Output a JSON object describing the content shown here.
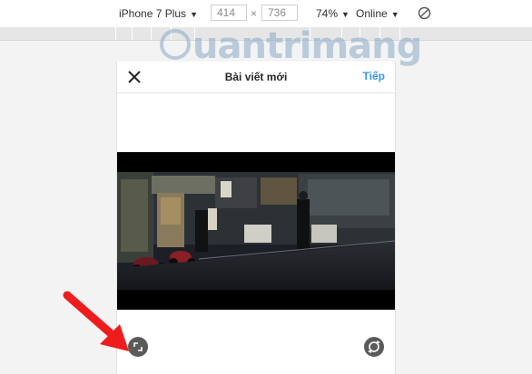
{
  "devtools": {
    "device": "iPhone 7 Plus",
    "width": "414",
    "separator": "×",
    "height": "736",
    "zoom": "74%",
    "network": "Online"
  },
  "watermark": {
    "text": "uantrimang"
  },
  "app": {
    "title": "Bài viết mới",
    "next_label": "Tiếp"
  },
  "icons": {
    "close": "close-icon",
    "expand": "expand-icon",
    "rotate": "rotate-icon",
    "no-touch": "rotate-disabled-icon",
    "arrow": "red-arrow-icon"
  },
  "colors": {
    "accent": "#3897f0",
    "arrow": "#ee1c1c"
  }
}
